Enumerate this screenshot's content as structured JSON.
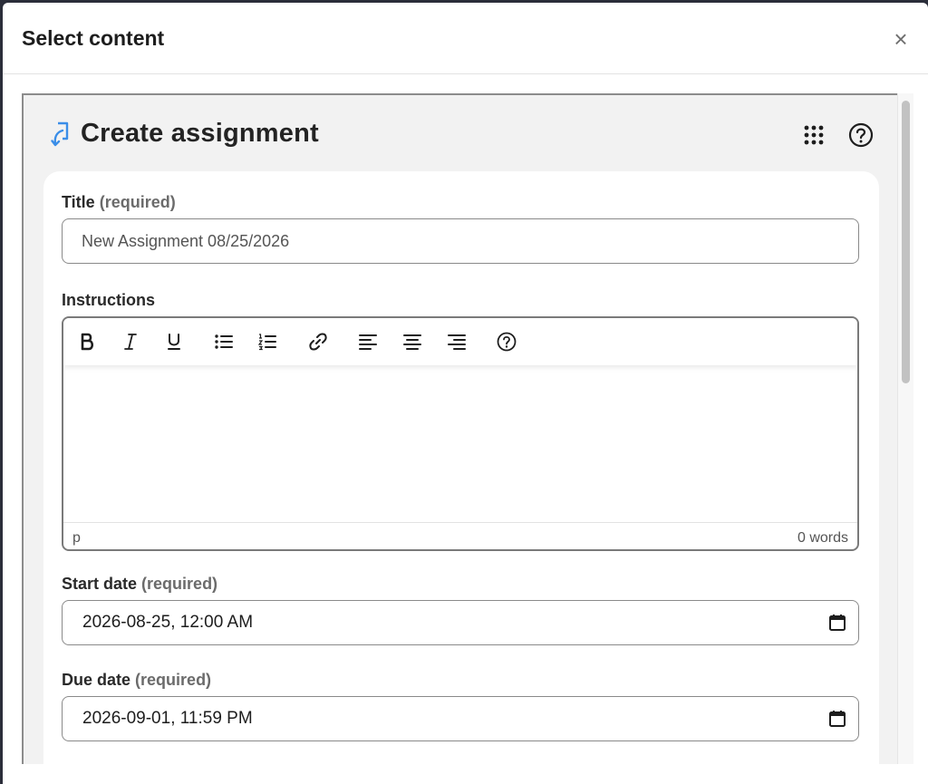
{
  "modal": {
    "title": "Select content",
    "close_label": "×"
  },
  "page": {
    "title": "Create assignment",
    "icons": {
      "assignment": "assignment-icon",
      "apps": "apps-grid-icon",
      "help": "help-circle-icon"
    },
    "accent_color": "#3b8ee8"
  },
  "form": {
    "title_field": {
      "label": "Title",
      "required": "(required)",
      "value": "New Assignment 08/25/2026"
    },
    "instructions": {
      "label": "Instructions",
      "toolbar": [
        "bold-icon",
        "italic-icon",
        "underline-icon",
        "bullet-list-icon",
        "numbered-list-icon",
        "link-icon",
        "align-left-icon",
        "align-center-icon",
        "align-right-icon",
        "help-icon"
      ],
      "status_path": "p",
      "word_count": "0 words"
    },
    "start_date": {
      "label": "Start date",
      "required": "(required)",
      "value": "2026-08-25, 12:00 AM"
    },
    "due_date": {
      "label": "Due date",
      "required": "(required)",
      "value": "2026-09-01, 11:59 PM"
    }
  }
}
